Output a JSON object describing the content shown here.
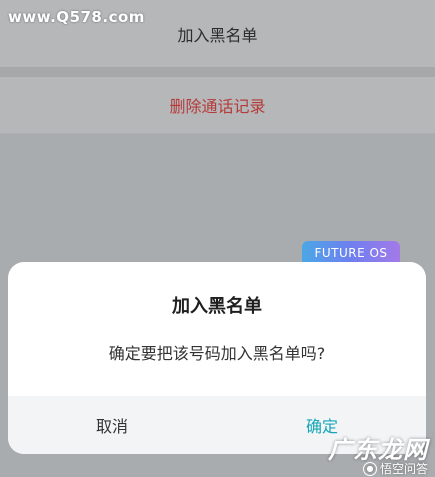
{
  "watermark_top": "www.Q578.com",
  "menu": {
    "add_to_blacklist": "加入黑名单",
    "delete_call_log": "删除通话记录"
  },
  "badge": {
    "label": "FUTURE OS"
  },
  "dialog": {
    "title": "加入黑名单",
    "message": "确定要把该号码加入黑名单吗?",
    "cancel_label": "取消",
    "confirm_label": "确定"
  },
  "watermark_bottom": {
    "brand": "广东龙网",
    "subtitle": "悟空问答"
  },
  "colors": {
    "confirm": "#15a6b7",
    "danger": "#b63b3b"
  }
}
